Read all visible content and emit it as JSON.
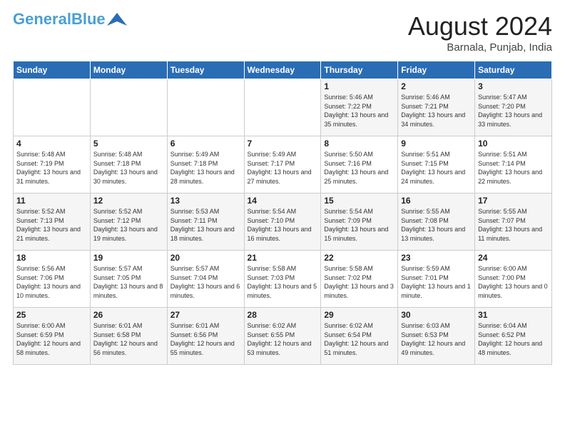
{
  "header": {
    "logo_line1": "General",
    "logo_line2": "Blue",
    "month_year": "August 2024",
    "location": "Barnala, Punjab, India"
  },
  "days_of_week": [
    "Sunday",
    "Monday",
    "Tuesday",
    "Wednesday",
    "Thursday",
    "Friday",
    "Saturday"
  ],
  "weeks": [
    [
      {
        "day": "",
        "sunrise": "",
        "sunset": "",
        "daylight": ""
      },
      {
        "day": "",
        "sunrise": "",
        "sunset": "",
        "daylight": ""
      },
      {
        "day": "",
        "sunrise": "",
        "sunset": "",
        "daylight": ""
      },
      {
        "day": "",
        "sunrise": "",
        "sunset": "",
        "daylight": ""
      },
      {
        "day": "1",
        "sunrise": "5:46 AM",
        "sunset": "7:22 PM",
        "daylight": "13 hours and 35 minutes."
      },
      {
        "day": "2",
        "sunrise": "5:46 AM",
        "sunset": "7:21 PM",
        "daylight": "13 hours and 34 minutes."
      },
      {
        "day": "3",
        "sunrise": "5:47 AM",
        "sunset": "7:20 PM",
        "daylight": "13 hours and 33 minutes."
      }
    ],
    [
      {
        "day": "4",
        "sunrise": "5:48 AM",
        "sunset": "7:19 PM",
        "daylight": "13 hours and 31 minutes."
      },
      {
        "day": "5",
        "sunrise": "5:48 AM",
        "sunset": "7:18 PM",
        "daylight": "13 hours and 30 minutes."
      },
      {
        "day": "6",
        "sunrise": "5:49 AM",
        "sunset": "7:18 PM",
        "daylight": "13 hours and 28 minutes."
      },
      {
        "day": "7",
        "sunrise": "5:49 AM",
        "sunset": "7:17 PM",
        "daylight": "13 hours and 27 minutes."
      },
      {
        "day": "8",
        "sunrise": "5:50 AM",
        "sunset": "7:16 PM",
        "daylight": "13 hours and 25 minutes."
      },
      {
        "day": "9",
        "sunrise": "5:51 AM",
        "sunset": "7:15 PM",
        "daylight": "13 hours and 24 minutes."
      },
      {
        "day": "10",
        "sunrise": "5:51 AM",
        "sunset": "7:14 PM",
        "daylight": "13 hours and 22 minutes."
      }
    ],
    [
      {
        "day": "11",
        "sunrise": "5:52 AM",
        "sunset": "7:13 PM",
        "daylight": "13 hours and 21 minutes."
      },
      {
        "day": "12",
        "sunrise": "5:52 AM",
        "sunset": "7:12 PM",
        "daylight": "13 hours and 19 minutes."
      },
      {
        "day": "13",
        "sunrise": "5:53 AM",
        "sunset": "7:11 PM",
        "daylight": "13 hours and 18 minutes."
      },
      {
        "day": "14",
        "sunrise": "5:54 AM",
        "sunset": "7:10 PM",
        "daylight": "13 hours and 16 minutes."
      },
      {
        "day": "15",
        "sunrise": "5:54 AM",
        "sunset": "7:09 PM",
        "daylight": "13 hours and 15 minutes."
      },
      {
        "day": "16",
        "sunrise": "5:55 AM",
        "sunset": "7:08 PM",
        "daylight": "13 hours and 13 minutes."
      },
      {
        "day": "17",
        "sunrise": "5:55 AM",
        "sunset": "7:07 PM",
        "daylight": "13 hours and 11 minutes."
      }
    ],
    [
      {
        "day": "18",
        "sunrise": "5:56 AM",
        "sunset": "7:06 PM",
        "daylight": "13 hours and 10 minutes."
      },
      {
        "day": "19",
        "sunrise": "5:57 AM",
        "sunset": "7:05 PM",
        "daylight": "13 hours and 8 minutes."
      },
      {
        "day": "20",
        "sunrise": "5:57 AM",
        "sunset": "7:04 PM",
        "daylight": "13 hours and 6 minutes."
      },
      {
        "day": "21",
        "sunrise": "5:58 AM",
        "sunset": "7:03 PM",
        "daylight": "13 hours and 5 minutes."
      },
      {
        "day": "22",
        "sunrise": "5:58 AM",
        "sunset": "7:02 PM",
        "daylight": "13 hours and 3 minutes."
      },
      {
        "day": "23",
        "sunrise": "5:59 AM",
        "sunset": "7:01 PM",
        "daylight": "13 hours and 1 minute."
      },
      {
        "day": "24",
        "sunrise": "6:00 AM",
        "sunset": "7:00 PM",
        "daylight": "13 hours and 0 minutes."
      }
    ],
    [
      {
        "day": "25",
        "sunrise": "6:00 AM",
        "sunset": "6:59 PM",
        "daylight": "12 hours and 58 minutes."
      },
      {
        "day": "26",
        "sunrise": "6:01 AM",
        "sunset": "6:58 PM",
        "daylight": "12 hours and 56 minutes."
      },
      {
        "day": "27",
        "sunrise": "6:01 AM",
        "sunset": "6:56 PM",
        "daylight": "12 hours and 55 minutes."
      },
      {
        "day": "28",
        "sunrise": "6:02 AM",
        "sunset": "6:55 PM",
        "daylight": "12 hours and 53 minutes."
      },
      {
        "day": "29",
        "sunrise": "6:02 AM",
        "sunset": "6:54 PM",
        "daylight": "12 hours and 51 minutes."
      },
      {
        "day": "30",
        "sunrise": "6:03 AM",
        "sunset": "6:53 PM",
        "daylight": "12 hours and 49 minutes."
      },
      {
        "day": "31",
        "sunrise": "6:04 AM",
        "sunset": "6:52 PM",
        "daylight": "12 hours and 48 minutes."
      }
    ]
  ]
}
